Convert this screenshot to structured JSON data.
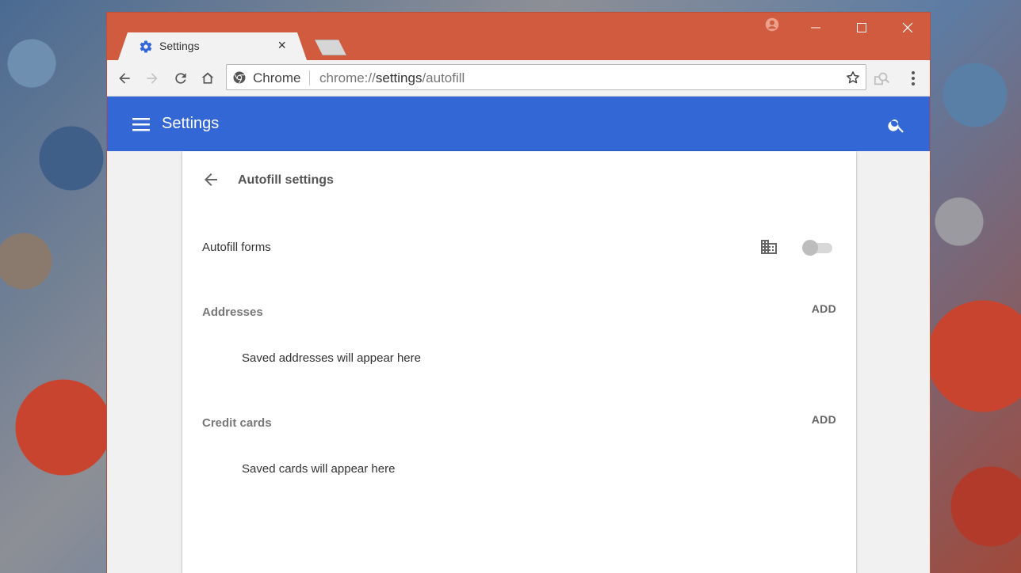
{
  "window": {
    "tab": {
      "title": "Settings",
      "close_glyph": "×"
    },
    "controls": {
      "minimize": "minimize",
      "maximize": "maximize",
      "close": "close"
    }
  },
  "toolbar": {
    "omnibox": {
      "chip": "Chrome",
      "url_prefix": "chrome://",
      "url_host": "settings",
      "url_path": "/autofill"
    }
  },
  "header": {
    "title": "Settings"
  },
  "page": {
    "title": "Autofill settings",
    "autofill_forms": {
      "label": "Autofill forms",
      "enabled": false,
      "managed": true
    },
    "addresses": {
      "label": "Addresses",
      "add_label": "ADD",
      "empty_text": "Saved addresses will appear here"
    },
    "credit_cards": {
      "label": "Credit cards",
      "add_label": "ADD",
      "empty_text": "Saved cards will appear here"
    }
  },
  "colors": {
    "frame": "#d05b3e",
    "header": "#3367d6",
    "tab_icon": "#3367d6"
  }
}
